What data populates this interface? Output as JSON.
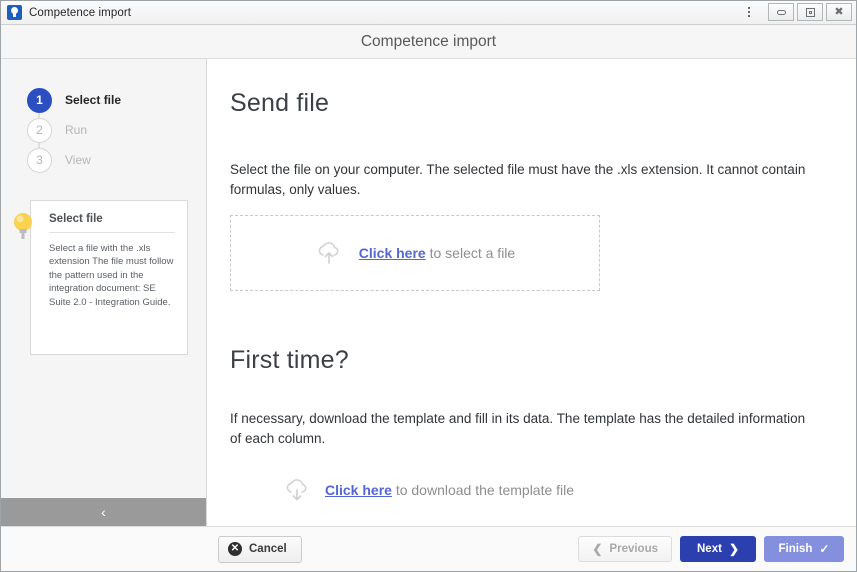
{
  "window": {
    "title": "Competence import",
    "app_icon": "lightbulb-app-icon",
    "controls": {
      "menu": "kebab-menu-icon",
      "minimize": "minimize-icon",
      "maximize": "maximize-icon",
      "close": "close-icon"
    }
  },
  "header": {
    "title": "Competence import"
  },
  "sidebar": {
    "steps": [
      {
        "number": "1",
        "label": "Select file",
        "state": "active"
      },
      {
        "number": "2",
        "label": "Run",
        "state": "inactive"
      },
      {
        "number": "3",
        "label": "View",
        "state": "inactive"
      }
    ],
    "tip": {
      "icon": "lightbulb-icon",
      "title": "Select file",
      "text": "Select a file with the .xls extension The file must follow the pattern used in the integration document: SE Suite 2.0 - Integration Guide."
    },
    "collapse": {
      "icon": "chevron-left-icon",
      "label": "‹"
    }
  },
  "main": {
    "section_1": {
      "heading": "Send file",
      "description": "Select the file on your computer. The selected file must have the .xls extension. It cannot contain formulas, only values.",
      "dropzone": {
        "icon": "cloud-upload-icon",
        "link_text": "Click here",
        "rest_text": " to select a file"
      }
    },
    "section_2": {
      "heading": "First time?",
      "description": "If necessary, download the template and fill in its data. The template has the detailed information of each column.",
      "download": {
        "icon": "cloud-download-icon",
        "link_text": "Click here",
        "rest_text": " to download the template file"
      }
    }
  },
  "footer": {
    "cancel": {
      "label": "Cancel",
      "icon": "cancel-circle-icon"
    },
    "previous": {
      "label": "Previous",
      "icon": "chevron-left-icon",
      "state": "disabled"
    },
    "next": {
      "label": "Next",
      "icon": "chevron-right-icon"
    },
    "finish": {
      "label": "Finish",
      "icon": "check-icon"
    }
  },
  "colors": {
    "accent_blue": "#2b3fae",
    "finish_blue": "#8490dd",
    "link_blue": "#5566d6",
    "step_active": "#2b4ec0",
    "collapse_bar": "#9a9a9a"
  }
}
